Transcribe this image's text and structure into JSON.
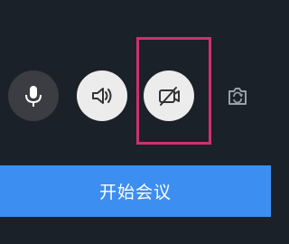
{
  "controls": {
    "mic_icon": "microphone-icon",
    "speaker_icon": "speaker-icon",
    "camera_off_icon": "camera-off-icon",
    "switch_camera_icon": "switch-camera-icon"
  },
  "colors": {
    "background": "#1b2129",
    "button_light": "#ececec",
    "button_dark": "#3b3d42",
    "highlight": "#d0306f",
    "primary": "#3d8ef1"
  },
  "start_meeting": {
    "label": "开始会议"
  }
}
